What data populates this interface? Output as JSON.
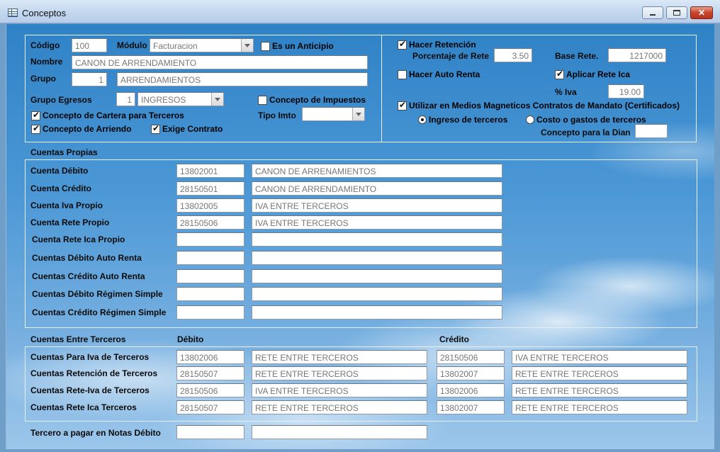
{
  "window": {
    "title": "Conceptos",
    "min_label": "",
    "max_label": "",
    "close_label": "✕"
  },
  "general": {
    "codigo_label": "Código",
    "codigo_value": "100",
    "modulo_label": "Módulo",
    "modulo_value": "Facturacion",
    "anticipio_label": "Es un Anticipio",
    "anticipio_checked": false,
    "nombre_label": "Nombre",
    "nombre_value": "CANON DE ARRENDAMIENTO",
    "grupo_label": "Grupo",
    "grupo_code": "1",
    "grupo_name": "ARRENDAMIENTOS",
    "grupo_egresos_label": "Grupo Egresos",
    "grupo_egresos_code": "1",
    "grupo_egresos_value": "INGRESOS",
    "impuestos_label": "Concepto de Impuestos",
    "impuestos_checked": false,
    "cartera_label": "Concepto de Cartera para Terceros",
    "cartera_checked": true,
    "tipo_imto_label": "Tipo Imto",
    "tipo_imto_value": "",
    "arriendo_label": "Concepto de Arriendo",
    "arriendo_checked": true,
    "exige_contrato_label": "Exige Contrato",
    "exige_contrato_checked": true
  },
  "retencion": {
    "hacer_retencion_label": "Hacer Retención",
    "hacer_retencion_checked": true,
    "porcentaje_label": "Porcentaje de Rete",
    "porcentaje_value": "3.50",
    "base_label": "Base Rete.",
    "base_value": "1217000",
    "auto_renta_label": "Hacer Auto Renta",
    "auto_renta_checked": false,
    "rete_ica_label": "Aplicar Rete Ica",
    "rete_ica_checked": true,
    "iva_label": "% Iva",
    "iva_value": "19.00",
    "medios_label": "Utilizar en Medios Magneticos Contratos de Mandato (Certificados)",
    "medios_checked": true,
    "ingreso_label": "Ingreso de terceros",
    "ingreso_selected": true,
    "costo_label": "Costo o gastos de terceros",
    "costo_selected": false,
    "dian_label": "Concepto para la Dian",
    "dian_value": ""
  },
  "propias": {
    "title": "Cuentas Propias",
    "rows": [
      {
        "label": "Cuenta Débito",
        "code": "13802001",
        "name": "CANON DE ARRENAMIENTOS"
      },
      {
        "label": "Cuenta Crédito",
        "code": "28150501",
        "name": "CANON DE ARRENDAMIENTO"
      },
      {
        "label": "Cuenta Iva Propio",
        "code": "13802005",
        "name": "IVA ENTRE TERCEROS"
      },
      {
        "label": "Cuenta Rete Propio",
        "code": "28150506",
        "name": "IVA ENTRE TERCEROS"
      },
      {
        "label": "Cuenta Rete Ica Propio",
        "code": "",
        "name": ""
      },
      {
        "label": "Cuentas Débito Auto Renta",
        "code": "",
        "name": ""
      },
      {
        "label": "Cuentas Crédito Auto Renta",
        "code": "",
        "name": ""
      },
      {
        "label": "Cuentas Débito Régimen Simple",
        "code": "",
        "name": ""
      },
      {
        "label": "Cuentas Crédito Régimen Simple",
        "code": "",
        "name": ""
      }
    ]
  },
  "terceros": {
    "title": "Cuentas Entre Terceros",
    "debito_header": "Débito",
    "credito_header": "Crédito",
    "rows": [
      {
        "label": "Cuentas Para Iva de Terceros",
        "deb_code": "13802006",
        "deb_name": "RETE ENTRE TERCEROS",
        "cred_code": "28150506",
        "cred_name": "IVA ENTRE TERCEROS"
      },
      {
        "label": "Cuentas Retención de Terceros",
        "deb_code": "28150507",
        "deb_name": "RETE ENTRE TERCEROS",
        "cred_code": "13802007",
        "cred_name": "RETE ENTRE TERCEROS"
      },
      {
        "label": "Cuentas Rete-Iva de Terceros",
        "deb_code": "28150506",
        "deb_name": "IVA ENTRE TERCEROS",
        "cred_code": "13802006",
        "cred_name": "RETE ENTRE TERCEROS"
      },
      {
        "label": "Cuentas Rete Ica Terceros",
        "deb_code": "28150507",
        "deb_name": "RETE ENTRE TERCEROS",
        "cred_code": "13802007",
        "cred_name": "RETE ENTRE TERCEROS"
      }
    ]
  },
  "notas": {
    "label": "Tercero a pagar en Notas Débito",
    "code": "",
    "name": ""
  }
}
